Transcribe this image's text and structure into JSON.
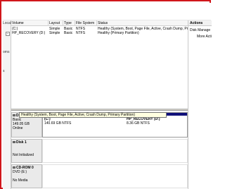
{
  "left_pane": {
    "fragments": [
      "Local",
      "oms",
      "s"
    ]
  },
  "volume_table": {
    "headers": [
      "Volume",
      "Layout",
      "Type",
      "File System",
      "Status"
    ],
    "rows": [
      [
        "(C:)",
        "Simple",
        "Basic",
        "NTFS",
        "Healthy (System, Boot, Page File, Active, Crash Dump, Prim"
      ],
      [
        "HP_RECOVERY (D:)",
        "Simple",
        "Basic",
        "NTFS",
        "Healthy (Primary Partition)"
      ]
    ]
  },
  "tooltip": "Healthy (System, Boot, Page File, Active, Crash Dump, Primary Partition)",
  "disks": [
    {
      "name": "Disk 0",
      "lines": [
        "Basic",
        "149.05 GB",
        "Online"
      ],
      "partitions": [
        {
          "name": "(C:)",
          "size": "140.69 GB NTFS",
          "status": "Healthy (System, Boot, Page File, Active, Crash Dump, Primary Partition)"
        },
        {
          "name": "HP_RECOVERY (D:)",
          "size": "8.36 GB NTFS",
          "status": "Healthy (Primary Partition)"
        }
      ]
    },
    {
      "name": "Disk 1",
      "lines": [
        "",
        "Not Initialized"
      ]
    },
    {
      "name": "CD-ROM 0",
      "lines": [
        "DVD (E:)",
        "",
        "No Media"
      ]
    }
  ],
  "actions": {
    "title": "Actions",
    "items": [
      "Disk Manage",
      "More Acti"
    ]
  },
  "colors": {
    "primary_partition_bar": "#10107a",
    "frame_border": "#d0161b",
    "tooltip_bg": "#ffffe1"
  }
}
